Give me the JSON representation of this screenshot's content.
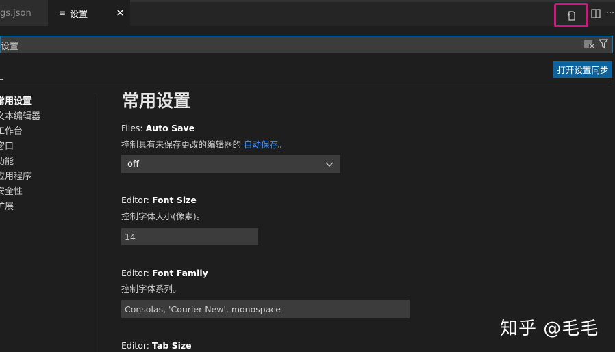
{
  "tabs": [
    {
      "label": "gs.json"
    },
    {
      "label": "设置",
      "icon": "file-lines-icon"
    }
  ],
  "toolbar": {
    "open_json_icon": "open-settings-json-icon",
    "split_icon": "split-editor-icon",
    "more_icon": "more-icon",
    "more_label": "···"
  },
  "search": {
    "value": "设置",
    "clear_icon": "clear-filter-icon",
    "filter_icon": "filter-icon"
  },
  "sync_button": "打开设置同步",
  "toc": [
    {
      "label": "常用设置",
      "active": true
    },
    {
      "label": "文本编辑器"
    },
    {
      "label": "工作台"
    },
    {
      "label": "窗口"
    },
    {
      "label": "功能"
    },
    {
      "label": "应用程序"
    },
    {
      "label": "安全性"
    },
    {
      "label": "扩展"
    }
  ],
  "content": {
    "heading": "常用设置",
    "settings": [
      {
        "category": "Files: ",
        "name": "Auto Save",
        "desc_prefix": "控制具有未保存更改的编辑器的 ",
        "desc_link": "自动保存",
        "desc_suffix": "。",
        "value": "off"
      },
      {
        "category": "Editor: ",
        "name": "Font Size",
        "desc": "控制字体大小(像素)。",
        "value": "14"
      },
      {
        "category": "Editor: ",
        "name": "Font Family",
        "desc": "控制字体系列。",
        "value": "Consolas, 'Courier New', monospace"
      },
      {
        "category": "Editor: ",
        "name": "Tab Size"
      }
    ]
  },
  "watermark": "知乎 @毛毛",
  "colors": {
    "accent": "#007acc",
    "button": "#0e639c",
    "highlight_box": "#d4147e",
    "link": "#3794ff"
  }
}
